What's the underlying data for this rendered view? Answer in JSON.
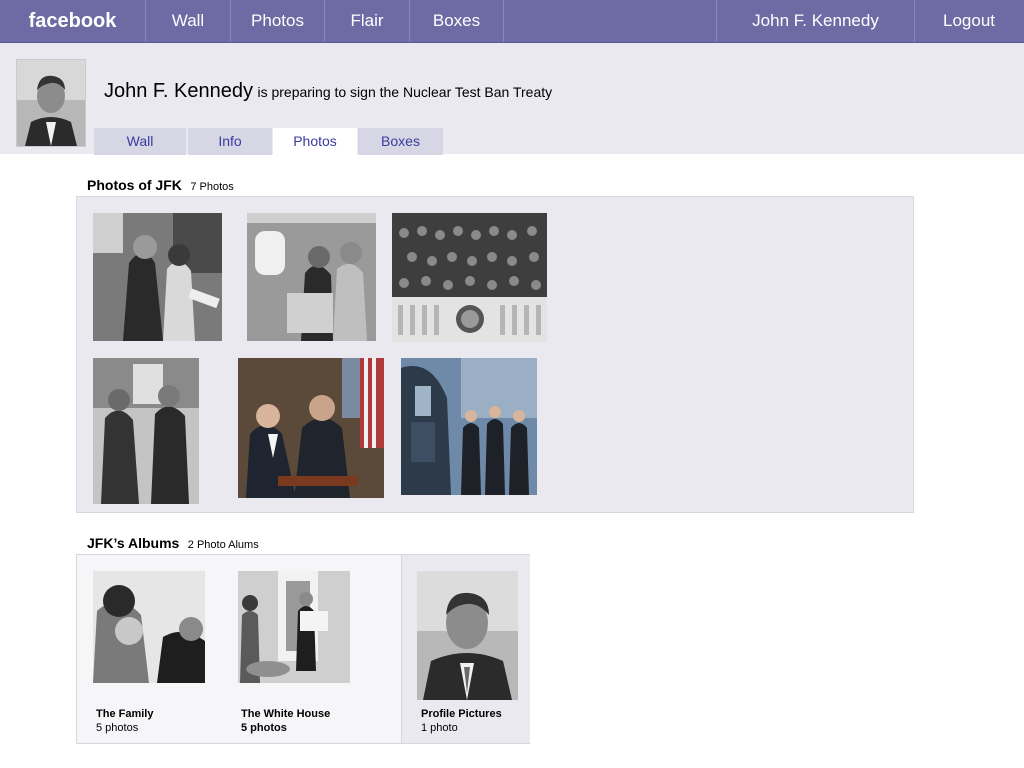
{
  "topnav": {
    "logo": "facebook",
    "items": [
      "Wall",
      "Photos",
      "Flair",
      "Boxes"
    ],
    "user": "John F. Kennedy",
    "logout": "Logout"
  },
  "profile": {
    "name": "John F. Kennedy",
    "status": "is preparing to sign the Nuclear Test Ban Treaty",
    "tabs": [
      "Wall",
      "Info",
      "Photos",
      "Boxes"
    ],
    "active_tab": "Photos"
  },
  "photos": {
    "title": "Photos of JFK",
    "count": "7 Photos"
  },
  "albums": {
    "title": "JFK’s Albums",
    "count": "2 Photo Alums",
    "items": [
      {
        "name": "The Family",
        "count": "5 photos"
      },
      {
        "name": "The White House",
        "count": "5 photos"
      },
      {
        "name": "Profile Pictures",
        "count": "1 photo"
      }
    ]
  },
  "colors": {
    "topbar": "#6d6aa4",
    "profilebar": "#e9e9ef",
    "tab_link": "#3b3b9f"
  }
}
